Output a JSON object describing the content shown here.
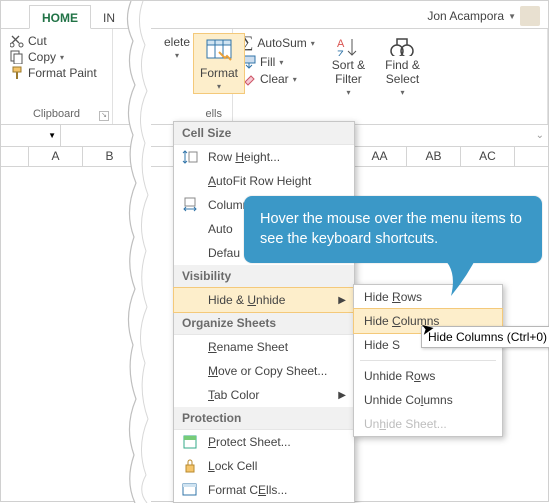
{
  "user": {
    "name": "Jon Acampora"
  },
  "tabs": {
    "home": "HOME",
    "other": "IN"
  },
  "ribbon": {
    "clipboard": {
      "label": "Clipboard",
      "cut": "Cut",
      "copy": "Copy",
      "format_painter": "Format Paint"
    },
    "cells": {
      "label": "ells",
      "delete": "elete",
      "format": "Format"
    },
    "editing": {
      "autosum": "AutoSum",
      "fill": "Fill",
      "clear": "Clear",
      "sort": "Sort &\nFilter",
      "find": "Find &\nSelect"
    }
  },
  "menu": {
    "sections": {
      "cell_size": "Cell Size",
      "visibility": "Visibility",
      "organize": "Organize Sheets",
      "protection": "Protection"
    },
    "row_height": "Row Height...",
    "autofit_row": "AutoFit Row Height",
    "column_width": "Column Width...",
    "autofit_col": "Auto",
    "default_width": "Defau",
    "hide_unhide": "Hide & Unhide",
    "rename": "Rename Sheet",
    "move_copy": "Move or Copy Sheet...",
    "tab_color": "Tab Color",
    "protect": "Protect Sheet...",
    "lock": "Lock Cell",
    "format_cells": "Format Cells..."
  },
  "submenu": {
    "hide_rows": "Hide Rows",
    "hide_cols": "Hide Columns",
    "hide_sheet": "Hide S",
    "unhide_rows": "Unhide Rows",
    "unhide_cols": "Unhide Columns",
    "unhide_sheet": "Unhide Sheet..."
  },
  "tooltip": "Hide Columns (Ctrl+0)",
  "callout": "Hover the mouse over the menu items to see the keyboard shortcuts.",
  "columns": {
    "a": "A",
    "b": "B",
    "aa": "AA",
    "ab": "AB",
    "ac": "AC"
  },
  "hotkeys": {
    "row_height_u": "H",
    "autofit_row_u": "A",
    "column_width_u": "W",
    "hide_unhide_u": "U",
    "rename_u": "R",
    "move_copy_u": "M",
    "tab_color_u": "T",
    "protect_u": "P",
    "lock_u": "L",
    "format_cells_u": "E",
    "hide_rows_u": "R",
    "hide_cols_u": "C",
    "unhide_rows_u": "o",
    "unhide_cols_u": "l",
    "unhide_sheet_u": "h"
  }
}
